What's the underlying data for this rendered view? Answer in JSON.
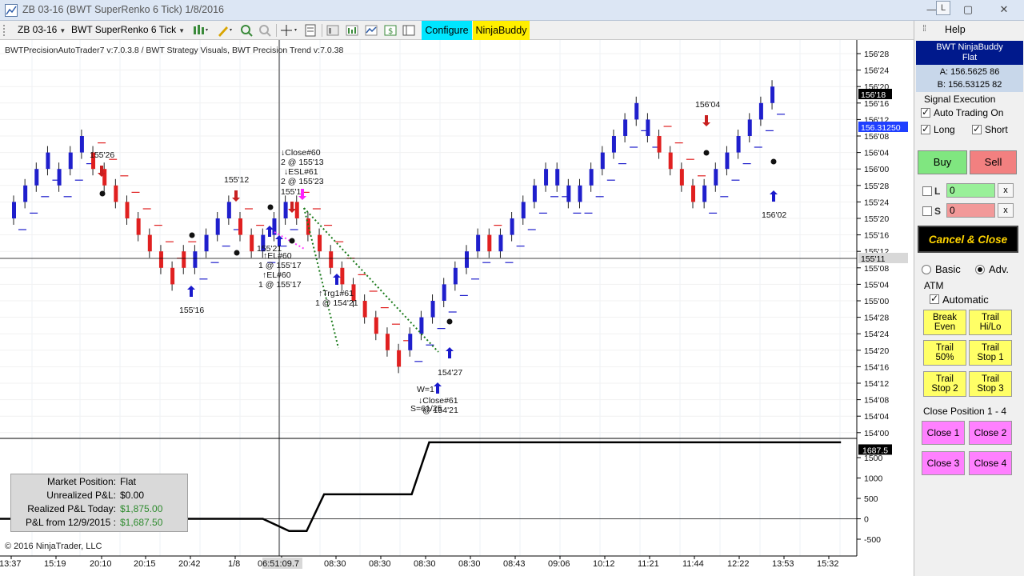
{
  "window": {
    "title": "ZB 03-16 (BWT SuperRenko  6 Tick)  1/8/2016",
    "link_badge": "L"
  },
  "toolbar": {
    "instrument": "ZB 03-16",
    "bar_type": "BWT SuperRenko  6 Tick",
    "configure_label": "Configure",
    "ninjabuddy_label": "NinjaBuddy",
    "configure_color": "#00e5ff",
    "ninjabuddy_color": "#ffee00"
  },
  "chart": {
    "indicator_label": "BWTPrecisionAutoTrader7 v:7.0.3.8 / BWT Strategy Visuals, BWT Precision Trend v:7.0.38",
    "copyright": "© 2016 NinjaTrader, LLC",
    "price_ticks": [
      "156'28",
      "156'24",
      "156'20",
      "156'16",
      "156'12",
      "156'08",
      "156'04",
      "156'00",
      "155'28",
      "155'24",
      "155'20",
      "155'16",
      "155'12",
      "155'08",
      "155'04",
      "155'00",
      "154'28",
      "154'24",
      "154'20",
      "154'16",
      "154'12",
      "154'08",
      "154'04",
      "154'00"
    ],
    "price_badges": {
      "last": "156'18",
      "bid": "156.31250",
      "crosshair": "155'11"
    },
    "pnl_ticks": [
      "1500",
      "1000",
      "500",
      "0",
      "-500"
    ],
    "pnl_badge": "1687.5",
    "time_labels": [
      "13:37",
      "15:19",
      "20:10",
      "20:15",
      "20:42",
      "1/8",
      "06:51:09.7",
      "08:30",
      "08:30",
      "08:30",
      "08:30",
      "08:43",
      "09:06",
      "10:12",
      "11:21",
      "11:44",
      "12:22",
      "13:53",
      "15:32"
    ],
    "annotations": {
      "a_15526": "155'26",
      "a_15512": "155'12",
      "a_15516": "155'16",
      "a_close60": "↓Close#60",
      "a_2at15513": "2 @ 155'13",
      "a_esl61": "↓ESL#61",
      "a_2at15523": "2 @ 155'23",
      "a_1551x": "155'1",
      "a_15521": "155'21",
      "a_el60": "↑EL#60",
      "a_1at15517a": "1 @ 155'17",
      "a_el60b": "↑EL#60",
      "a_1at15517b": "1 @ 155'17",
      "a_trg161": "↑Trg1#61",
      "a_1at15421": "1 @ 154'21",
      "a_15427": "154'27",
      "a_w1": "W=1",
      "a_close61": "↓Close#61",
      "a_s161": "S=61/25",
      "a_at15421": "@ 154'21",
      "a_15604": "156'04",
      "a_15602": "156'02"
    }
  },
  "pnl_box": {
    "rows": [
      {
        "label": "Market Position:",
        "value": "Flat",
        "green": false
      },
      {
        "label": "Unrealized P&L:",
        "value": "$0.00",
        "green": false
      },
      {
        "label": "Realized P&L Today:",
        "value": "$1,875.00",
        "green": true
      },
      {
        "label": "P&L from 12/9/2015 :",
        "value": "$1,687.50",
        "green": true
      }
    ]
  },
  "panel": {
    "help_label": "Help",
    "status_title": "BWT NinjaBuddy",
    "status_value": "Flat",
    "ask": "A: 156.5625 86",
    "bid": "B: 156.53125 82",
    "signal_execution": "Signal Execution",
    "auto_trading": "Auto Trading On",
    "long": "Long",
    "short": "Short",
    "buy": "Buy",
    "sell": "Sell",
    "l_label": "L",
    "s_label": "S",
    "l_value": "0",
    "s_value": "0",
    "x_label": "x",
    "cancel_close": "Cancel & Close",
    "basic": "Basic",
    "adv": "Adv.",
    "atm": "ATM",
    "automatic": "Automatic",
    "break_even": [
      "Break",
      "Even"
    ],
    "trail_hilo": [
      "Trail",
      "Hi/Lo"
    ],
    "trail_50": [
      "Trail",
      "50%"
    ],
    "trail_stop1": [
      "Trail",
      "Stop 1"
    ],
    "trail_stop2": [
      "Trail",
      "Stop 2"
    ],
    "trail_stop3": [
      "Trail",
      "Stop 3"
    ],
    "close_position": "Close Position 1 - 4",
    "close1": "Close 1",
    "close2": "Close 2",
    "close3": "Close 3",
    "close4": "Close 4"
  },
  "colors": {
    "bull": "#1f1fcc",
    "bear": "#e02020",
    "trend_dots": "#1a7a1a",
    "pnl_line": "#000000"
  },
  "chart_data": {
    "type": "candlestick",
    "price_axis_unit": "32nds",
    "ylim_price": [
      "154'00",
      "156'28"
    ],
    "ylim_pnl": [
      -500,
      1500
    ],
    "bars": [
      {
        "o": "155'20",
        "c": "155'24",
        "d": "up"
      },
      {
        "o": "155'24",
        "c": "155'28",
        "d": "up"
      },
      {
        "o": "155'28",
        "c": "156'00",
        "d": "up"
      },
      {
        "o": "156'00",
        "c": "156'04",
        "d": "up"
      },
      {
        "o": "155'28",
        "c": "156'00",
        "d": "up"
      },
      {
        "o": "156'00",
        "c": "156'04",
        "d": "up"
      },
      {
        "o": "156'04",
        "c": "156'08",
        "d": "up"
      },
      {
        "o": "156'04",
        "c": "156'00",
        "d": "down"
      },
      {
        "o": "156'00",
        "c": "155'28",
        "d": "down"
      },
      {
        "o": "155'28",
        "c": "155'24",
        "d": "down"
      },
      {
        "o": "155'24",
        "c": "155'20",
        "d": "down"
      },
      {
        "o": "155'20",
        "c": "155'16",
        "d": "down"
      },
      {
        "o": "155'16",
        "c": "155'12",
        "d": "down"
      },
      {
        "o": "155'12",
        "c": "155'08",
        "d": "down"
      },
      {
        "o": "155'08",
        "c": "155'04",
        "d": "down"
      },
      {
        "o": "155'12",
        "c": "155'08",
        "d": "down"
      },
      {
        "o": "155'08",
        "c": "155'12",
        "d": "up"
      },
      {
        "o": "155'12",
        "c": "155'16",
        "d": "up"
      },
      {
        "o": "155'16",
        "c": "155'20",
        "d": "up"
      },
      {
        "o": "155'20",
        "c": "155'24",
        "d": "up"
      },
      {
        "o": "155'20",
        "c": "155'16",
        "d": "down"
      },
      {
        "o": "155'16",
        "c": "155'12",
        "d": "down"
      },
      {
        "o": "155'12",
        "c": "155'16",
        "d": "up"
      },
      {
        "o": "155'16",
        "c": "155'20",
        "d": "up"
      },
      {
        "o": "155'20",
        "c": "155'24",
        "d": "up"
      },
      {
        "o": "155'24",
        "c": "155'20",
        "d": "down"
      },
      {
        "o": "155'20",
        "c": "155'16",
        "d": "down"
      },
      {
        "o": "155'16",
        "c": "155'12",
        "d": "down"
      },
      {
        "o": "155'12",
        "c": "155'08",
        "d": "down"
      },
      {
        "o": "155'08",
        "c": "155'04",
        "d": "down"
      },
      {
        "o": "155'04",
        "c": "155'00",
        "d": "down"
      },
      {
        "o": "155'00",
        "c": "154'28",
        "d": "down"
      },
      {
        "o": "154'28",
        "c": "154'24",
        "d": "down"
      },
      {
        "o": "154'24",
        "c": "154'20",
        "d": "down"
      },
      {
        "o": "154'20",
        "c": "154'16",
        "d": "down"
      },
      {
        "o": "154'20",
        "c": "154'24",
        "d": "up"
      },
      {
        "o": "154'24",
        "c": "154'28",
        "d": "up"
      },
      {
        "o": "154'28",
        "c": "155'00",
        "d": "up"
      },
      {
        "o": "155'00",
        "c": "155'04",
        "d": "up"
      },
      {
        "o": "155'04",
        "c": "155'08",
        "d": "up"
      },
      {
        "o": "155'08",
        "c": "155'12",
        "d": "up"
      },
      {
        "o": "155'12",
        "c": "155'16",
        "d": "up"
      },
      {
        "o": "155'16",
        "c": "155'12",
        "d": "down"
      },
      {
        "o": "155'12",
        "c": "155'16",
        "d": "up"
      },
      {
        "o": "155'16",
        "c": "155'20",
        "d": "up"
      },
      {
        "o": "155'20",
        "c": "155'24",
        "d": "up"
      },
      {
        "o": "155'24",
        "c": "155'28",
        "d": "up"
      },
      {
        "o": "155'28",
        "c": "156'00",
        "d": "up"
      },
      {
        "o": "156'00",
        "c": "155'28",
        "d": "up"
      },
      {
        "o": "155'28",
        "c": "155'24",
        "d": "up"
      },
      {
        "o": "155'24",
        "c": "155'28",
        "d": "up"
      },
      {
        "o": "155'28",
        "c": "156'00",
        "d": "up"
      },
      {
        "o": "156'00",
        "c": "156'04",
        "d": "up"
      },
      {
        "o": "156'04",
        "c": "156'08",
        "d": "up"
      },
      {
        "o": "156'08",
        "c": "156'12",
        "d": "up"
      },
      {
        "o": "156'12",
        "c": "156'16",
        "d": "up"
      },
      {
        "o": "156'08",
        "c": "156'12",
        "d": "up"
      },
      {
        "o": "156'08",
        "c": "156'04",
        "d": "down"
      },
      {
        "o": "156'04",
        "c": "156'00",
        "d": "down"
      },
      {
        "o": "156'00",
        "c": "155'28",
        "d": "down"
      },
      {
        "o": "155'28",
        "c": "155'24",
        "d": "down"
      },
      {
        "o": "155'24",
        "c": "155'28",
        "d": "up"
      },
      {
        "o": "155'28",
        "c": "156'00",
        "d": "up"
      },
      {
        "o": "156'00",
        "c": "156'04",
        "d": "up"
      },
      {
        "o": "156'04",
        "c": "156'08",
        "d": "up"
      },
      {
        "o": "156'08",
        "c": "156'12",
        "d": "up"
      },
      {
        "o": "156'12",
        "c": "156'16",
        "d": "up"
      },
      {
        "o": "156'16",
        "c": "156'20",
        "d": "up"
      }
    ],
    "pnl_series": {
      "name": "",
      "points": [
        [
          0,
          0
        ],
        [
          0.3,
          0
        ],
        [
          0.33,
          -300
        ],
        [
          0.35,
          -300
        ],
        [
          0.37,
          600
        ],
        [
          0.47,
          600
        ],
        [
          0.49,
          1875
        ],
        [
          0.96,
          1875
        ]
      ]
    }
  }
}
